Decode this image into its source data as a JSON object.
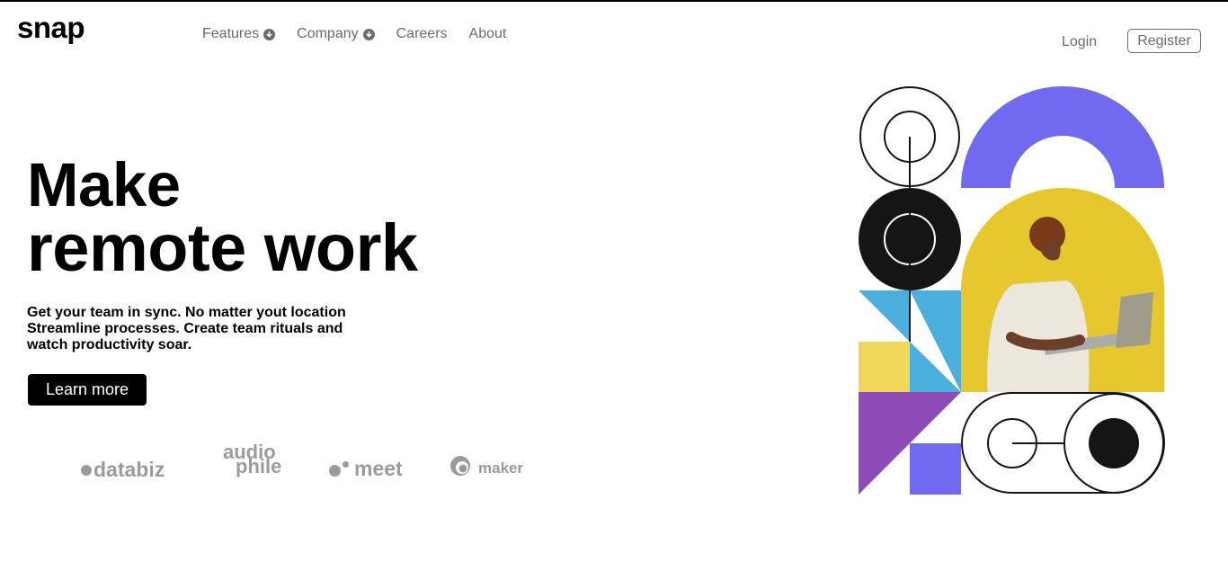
{
  "brand": {
    "logo": "snap"
  },
  "nav": {
    "items": [
      {
        "label": "Features",
        "dropdown": true
      },
      {
        "label": "Company",
        "dropdown": true
      },
      {
        "label": "Careers",
        "dropdown": false
      },
      {
        "label": "About",
        "dropdown": false
      }
    ]
  },
  "auth": {
    "login": "Login",
    "register": "Register"
  },
  "hero": {
    "title_line1": "Make",
    "title_line2": "remote work",
    "desc_line1": "Get your team in sync. No matter yout location",
    "desc_line2": "Streamline processes. Create team rituals and",
    "desc_line3": "watch productivity soar.",
    "cta": "Learn more"
  },
  "clients": {
    "databiz": "databiz",
    "audio_top": "audio",
    "audio_bottom": "phile",
    "meet": "meet",
    "maker": "maker"
  },
  "colors": {
    "purple": "#7169ef",
    "blue": "#4aafdc",
    "yellow": "#efd85a",
    "violet": "#8e4bb7",
    "black": "#151515",
    "photo_bg": "#e6c82e"
  },
  "icons": {
    "chevron": "chevron-down-circle-icon"
  }
}
